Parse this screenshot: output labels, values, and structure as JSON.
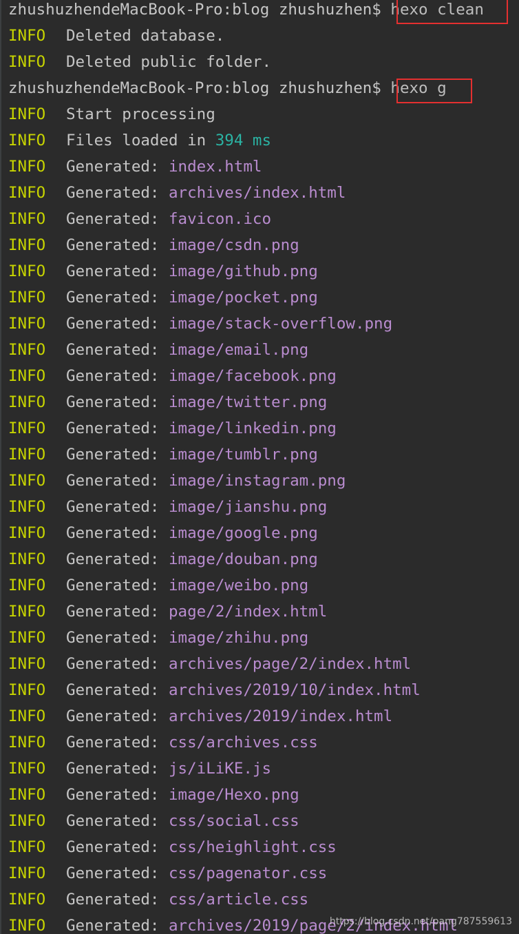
{
  "terminal": {
    "prompt_1": "zhushuzhendeMacBook-Pro:blog zhushuzhen$ ",
    "command_1": "hexo clean",
    "info_1_level": "INFO",
    "info_1_message": "Deleted database.",
    "info_2_level": "INFO",
    "info_2_message": "Deleted public folder.",
    "prompt_2": "zhushuzhendeMacBook-Pro:blog zhushuzhen$ ",
    "command_2": "hexo g",
    "info_3_level": "INFO",
    "info_3_message": "Start processing",
    "info_4_level": "INFO",
    "info_4_message": "Files loaded in ",
    "info_4_value": "394 ms",
    "generated_level": "INFO",
    "generated_label": "Generated: ",
    "generated_files": [
      "index.html",
      "archives/index.html",
      "favicon.ico",
      "image/csdn.png",
      "image/github.png",
      "image/pocket.png",
      "image/stack-overflow.png",
      "image/email.png",
      "image/facebook.png",
      "image/twitter.png",
      "image/linkedin.png",
      "image/tumblr.png",
      "image/instagram.png",
      "image/jianshu.png",
      "image/google.png",
      "image/douban.png",
      "image/weibo.png",
      "page/2/index.html",
      "image/zhihu.png",
      "archives/page/2/index.html",
      "archives/2019/10/index.html",
      "archives/2019/index.html",
      "css/archives.css",
      "js/iLiKE.js",
      "image/Hexo.png",
      "css/social.css",
      "css/heighlight.css",
      "css/pagenator.css",
      "css/article.css",
      "archives/2019/page/2/index.html"
    ],
    "highlight_color": "#e53030",
    "level_color": "#c7d400",
    "path_color": "#b98ccf",
    "number_color": "#2bb3a3"
  },
  "watermark": "https://blog.csdn.net/pang787559613"
}
